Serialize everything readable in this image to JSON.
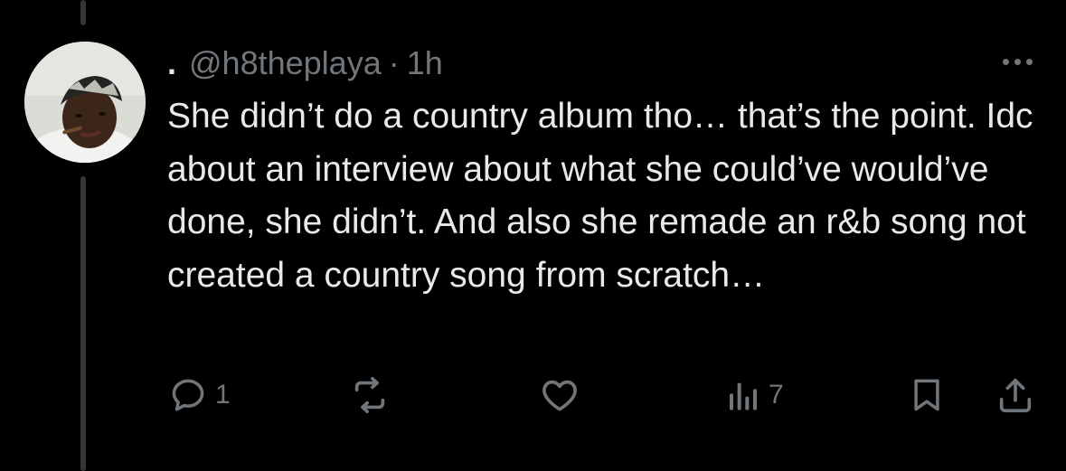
{
  "post": {
    "display_name": ".",
    "handle": "@h8theplaya",
    "separator": "·",
    "time": "1h",
    "text": "She didn’t do a country album tho… that’s the point. Idc about an interview about what she could’ve would’ve done, she didn’t. And also she remade an r&b song not created a country song from scratch…"
  },
  "actions": {
    "reply_count": "1",
    "repost_count": "",
    "like_count": "",
    "views_count": "7"
  },
  "icons": {
    "more": "more-horizontal-icon",
    "reply": "reply-bubble-icon",
    "repost": "repost-arrows-icon",
    "like": "heart-icon",
    "views": "views-bar-chart-icon",
    "bookmark": "bookmark-icon",
    "share": "share-upload-icon"
  },
  "colors": {
    "background": "#000000",
    "text_primary": "#e7e9ea",
    "text_secondary": "#71767b",
    "thread_line": "#333639"
  }
}
